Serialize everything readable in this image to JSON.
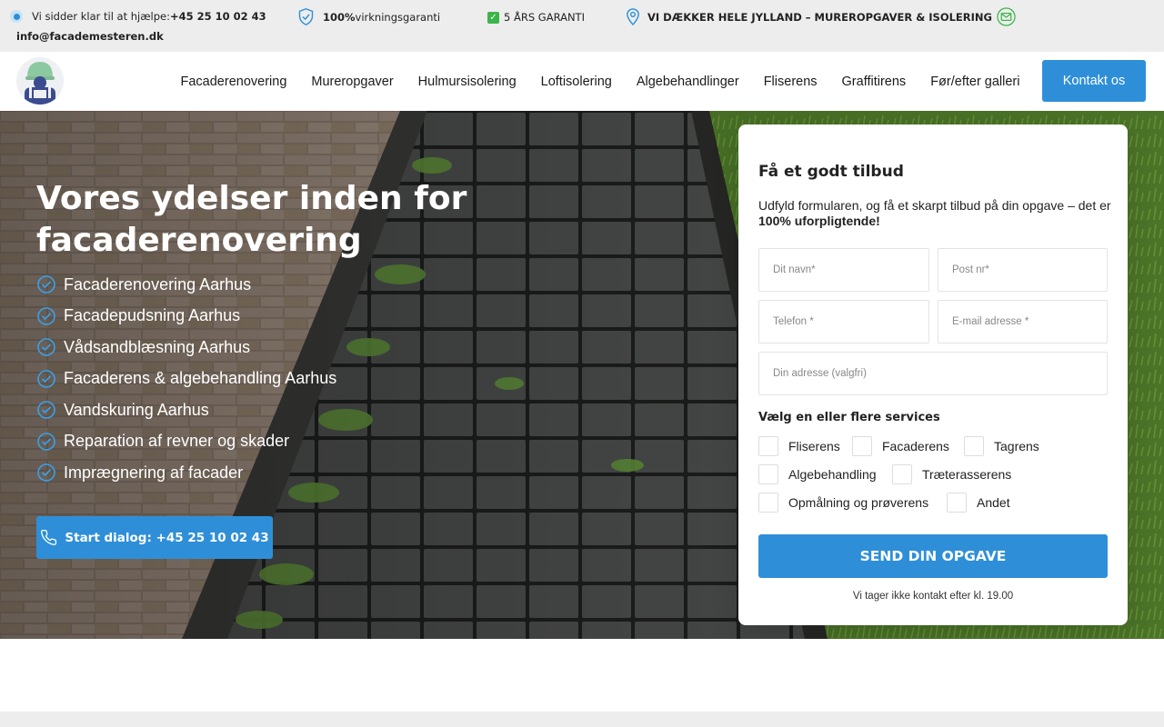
{
  "topbar": {
    "help_prefix": "Vi sidder klar til at hjælpe: ",
    "help_phone": "+45 25 10 02 43",
    "guarantee_bold": "100%",
    "guarantee_rest": " virkningsgaranti",
    "warranty": "5 ÅRS GARANTI",
    "coverage": "VI DÆKKER HELE JYLLAND – MUREROPGAVER & ISOLERING",
    "email": "info@facademesteren.dk"
  },
  "nav": {
    "items": [
      "Facaderenovering",
      "Mureropgaver",
      "Hulmursisolering",
      "Loftisolering",
      "Algebehandlinger",
      "Fliserens",
      "Graffitirens",
      "Før/efter galleri"
    ],
    "cta": "Kontakt os"
  },
  "hero": {
    "title": "Vores ydelser inden for facaderenovering",
    "services": [
      "Facaderenovering Aarhus",
      "Facadepudsning Aarhus",
      "Vådsandblæsning Aarhus",
      "Facaderens & algebehandling Aarhus",
      "Vandskuring Aarhus",
      "Reparation af revner og skader",
      "Imprægnering af facader"
    ],
    "dialog_button": "Start dialog: +45 25 10 02 43"
  },
  "form": {
    "title": "Få et godt tilbud",
    "lead_text": "Udfyld formularen, og få et skarpt tilbud på din opgave – det er ",
    "lead_bold": "100% uforpligtende!",
    "placeholders": {
      "name": "Dit navn*",
      "zip": "Post nr*",
      "phone": "Telefon *",
      "email": "E-mail adresse *",
      "address": "Din adresse (valgfri)"
    },
    "services_title": "Vælg en eller flere services",
    "options": [
      "Fliserens",
      "Facaderens",
      "Tagrens",
      "Algebehandling",
      "Træterasserens",
      "Opmålning og prøverens",
      "Andet"
    ],
    "submit": "SEND DIN OPGAVE",
    "note": "Vi tager ikke kontakt efter kl. 19.00"
  },
  "colors": {
    "accent": "#2e8fd8",
    "topbar_bg": "#ededed"
  }
}
